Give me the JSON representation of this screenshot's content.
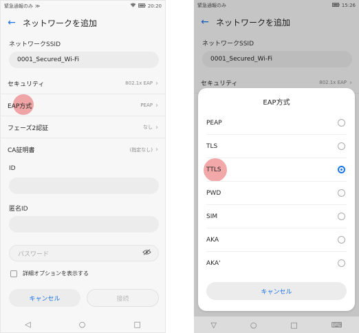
{
  "left": {
    "status": {
      "left": "緊急通報のみ",
      "time": "20:20",
      "icons": [
        "wifi-icon",
        "battery-icon"
      ]
    },
    "title": "ネットワークを追加",
    "ssid_label": "ネットワークSSID",
    "ssid_value": "0001_Secured_Wi-Fi",
    "rows": [
      {
        "label": "セキュリティ",
        "value": "802.1x EAP"
      },
      {
        "label": "EAP方式",
        "value": "PEAP"
      },
      {
        "label": "フェーズ2認証",
        "value": "なし"
      },
      {
        "label": "CA証明書",
        "value": "(指定なし)"
      }
    ],
    "id_label": "ID",
    "anon_label": "匿名ID",
    "password_placeholder": "パスワード",
    "advanced_label": "詳細オプションを表示する",
    "cancel": "キャンセル",
    "connect": "接続"
  },
  "right": {
    "status": {
      "left": "緊急通報のみ",
      "time": "15:26",
      "icons": [
        "battery-icon"
      ]
    },
    "title": "ネットワークを追加",
    "ssid_label": "ネットワークSSID",
    "ssid_value": "0001_Secured_Wi-Fi",
    "security_label": "セキュリティ",
    "security_value": "802.1x EAP",
    "dialog": {
      "title": "EAP方式",
      "options": [
        "PEAP",
        "TLS",
        "TTLS",
        "PWD",
        "SIM",
        "AKA",
        "AKA'"
      ],
      "selected": "TTLS",
      "cancel": "キャンセル"
    }
  },
  "colors": {
    "accent": "#1a73e8",
    "highlight": "#e96e6e"
  }
}
